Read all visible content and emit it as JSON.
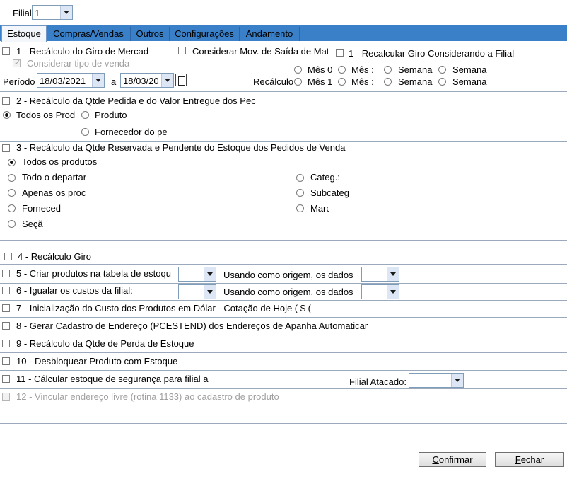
{
  "filial": {
    "label": "Filial",
    "value": "1"
  },
  "tabs": [
    "Estoque",
    "Compras/Vendas",
    "Outros",
    "Configurações",
    "Andamento"
  ],
  "row1": {
    "opt1": "1 - Recálculo do Giro de Mercad",
    "consider_tipo": "Considerar tipo de venda",
    "consider_mov": "Considerar Mov. de Saída de Mat",
    "recalc_filial": "1 - Recalcular Giro Considerando a Filial",
    "periodo_label": "Período",
    "date_from": "18/03/2021",
    "a_label": "a",
    "date_to": "18/03/20",
    "recalculo_label": "Recálculo",
    "mes0": "Mês 0",
    "mes1": "Mês 1",
    "mes_a": "Mês :",
    "mes_b": "Mês :",
    "semana_a": "Semana",
    "semana_b": "Semana",
    "semana_c": "Semana",
    "semana_d": "Semana"
  },
  "section2": {
    "title": "2 - Recálculo da Qtde Pedida e do Valor Entregue dos Pec",
    "todos": "Todos os Prod",
    "produto": "Produto",
    "fornecedor": "Fornecedor do pe"
  },
  "section3": {
    "title": "3 - Recálculo da Qtde Reservada e Pendente do Estoque dos Pedidos de Venda",
    "todos": "Todos os produtos",
    "departamento": "Todo o departar",
    "apenas": "Apenas os proc",
    "fornecedor": "Forneced",
    "secao": "Seçã",
    "categoria": "Categ.:",
    "subcategoria": "Subcateg",
    "marca": "Marc"
  },
  "section4": {
    "title": "4 - Recálculo Giro"
  },
  "section5": {
    "title": "5 - Criar produtos na tabela de estoqu",
    "origem": "Usando como origem, os dados"
  },
  "section6": {
    "title": "6 - Igualar os custos da filial:",
    "origem": "Usando como origem, os dados"
  },
  "section7": {
    "title": "7 - Inicialização do Custo dos Produtos em Dólar - Cotação de Hoje ( $ ("
  },
  "section8": {
    "title": "8 - Gerar Cadastro de Endereço (PCESTEND) dos Endereços de Apanha Automaticar"
  },
  "section9": {
    "title": "9 - Recálculo da Qtde de Perda de Estoque"
  },
  "section10": {
    "title": "10 - Desbloquear Produto com Estoque"
  },
  "section11": {
    "title": "11 - Cálcular estoque de segurança para filial a",
    "filial_atacado": "Filial Atacado:"
  },
  "section12": {
    "title": "12 - Vincular endereço livre (rotina 1133) ao cadastro de produto"
  },
  "buttons": {
    "confirmar_u": "C",
    "confirmar_rest": "onfirmar",
    "fechar_u": "F",
    "fechar_rest": "echar"
  }
}
